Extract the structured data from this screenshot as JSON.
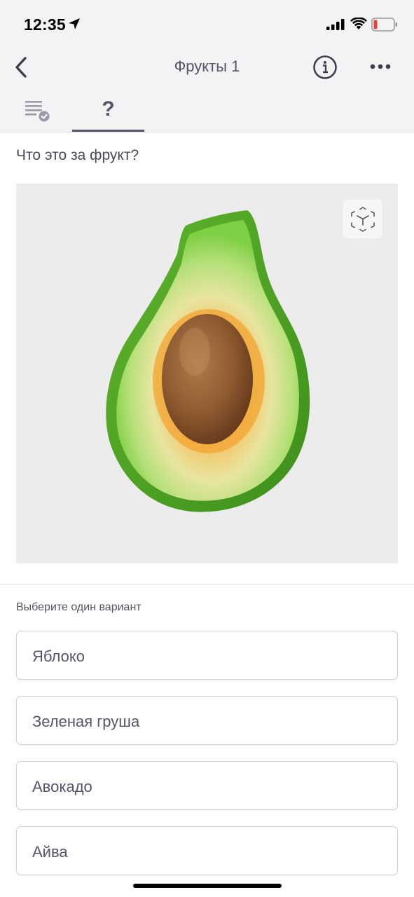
{
  "status_bar": {
    "time": "12:35",
    "location_icon": "location-arrow-icon",
    "signal_icon": "cellular-signal-icon",
    "wifi_icon": "wifi-icon",
    "battery_icon": "battery-low-icon",
    "battery_color": "#e8413c"
  },
  "nav": {
    "title": "Фрукты 1",
    "back_icon": "chevron-left-icon",
    "info_icon": "info-circle-icon",
    "more_icon": "more-horizontal-icon"
  },
  "tabs": [
    {
      "icon": "checklist-icon",
      "selected": false
    },
    {
      "label": "?",
      "selected": true
    }
  ],
  "question": {
    "text": "Что это за фрукт?",
    "image_subject": "avocado-half",
    "ar_icon": "ar-cube-icon"
  },
  "answers": {
    "prompt": "Выберите один вариант",
    "options": [
      "Яблоко",
      "Зеленая груша",
      "Авокадо",
      "Айва"
    ]
  },
  "colors": {
    "accent": "#55556a",
    "header_bg": "#f3f3f5",
    "image_bg": "#ececec"
  }
}
